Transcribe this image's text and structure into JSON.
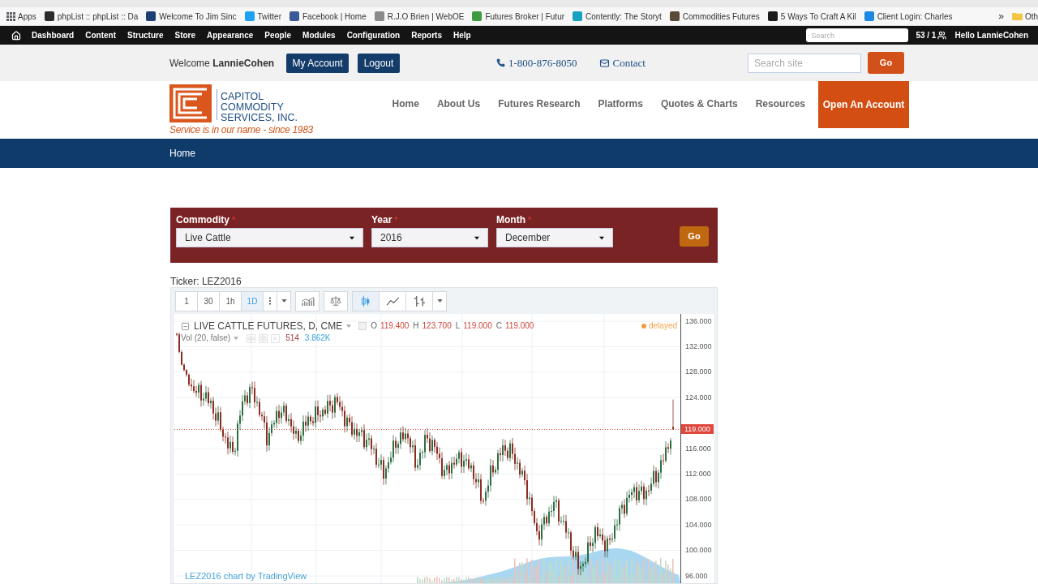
{
  "browser": {
    "apps": "Apps",
    "bookmarks": [
      "phpList :: phpList :: Da",
      "Welcome To Jim Sinc",
      "Twitter",
      "Facebook | Home",
      "R.J.O Brien | WebOE",
      "Futures Broker | Futur",
      "Contently: The Storyt",
      "Commodities Futures",
      "5 Ways To Craft A Kil",
      "Client Login: Charles"
    ],
    "overflow": "»",
    "other_bookmarks": "Oth"
  },
  "admin_toolbar": {
    "items": [
      "Dashboard",
      "Content",
      "Structure",
      "Store",
      "Appearance",
      "People",
      "Modules",
      "Configuration",
      "Reports",
      "Help"
    ],
    "search": {
      "placeholder": "Search"
    },
    "online_count": "53 / 1",
    "greeting": "Hello LannieCohen"
  },
  "header": {
    "welcome": "Welcome **LannieCohen**",
    "buttons": [
      "My Account",
      "Logout"
    ],
    "phone": "1-800-876-8050",
    "contact": "Contact",
    "search": {
      "placeholder": "Search site"
    },
    "search_button": "Go"
  },
  "logo": {
    "name_lines": [
      "CAPITOL",
      "COMMODITY",
      "SERVICES, INC."
    ],
    "tagline": "Service is in our name - since 1983"
  },
  "nav": {
    "items": [
      "Home",
      "About Us",
      "Futures Research",
      "Platforms",
      "Quotes & Charts",
      "Resources"
    ],
    "cta": "Open An Account"
  },
  "breadcrumb": [
    "Home"
  ],
  "selector": {
    "required_mark": "*",
    "fields": [
      {
        "label": "Commodity",
        "required": true,
        "value": "Live Cattle"
      },
      {
        "label": "Year",
        "required": true,
        "value": "2016"
      },
      {
        "label": "Month",
        "required": true,
        "value": "December"
      }
    ],
    "button": "Go"
  },
  "ticker": "Ticker: LEZ2016",
  "chart_widget": {
    "intervals": [
      {
        "label": "1",
        "selected": false
      },
      {
        "label": "30",
        "selected": false
      },
      {
        "label": "1h",
        "selected": false
      },
      {
        "label": "1D",
        "selected": true
      }
    ],
    "chart_styles": [
      {
        "kind": "candles",
        "selected": true
      },
      {
        "kind": "line",
        "selected": false
      },
      {
        "kind": "bars",
        "selected": false
      }
    ],
    "legend": {
      "title": "LIVE CATTLE FUTURES, D, CME",
      "ohlc": [
        {
          "key": "O",
          "value": "119.400"
        },
        {
          "key": "H",
          "value": "123.700"
        },
        {
          "key": "L",
          "value": "119.000"
        },
        {
          "key": "C",
          "value": "119.000"
        }
      ]
    },
    "volume": {
      "title": "Vol (20, false)",
      "values": [
        {
          "value": "514",
          "color": "#a8383a"
        },
        {
          "value": "3.862K",
          "color": "#3aa3dc"
        }
      ]
    },
    "status": "delayed",
    "price_scale": [
      {
        "kind": "tick",
        "label": "136.000"
      },
      {
        "kind": "tick",
        "label": "132.000"
      },
      {
        "kind": "tick",
        "label": "128.000"
      },
      {
        "kind": "tick",
        "label": "124.000"
      },
      {
        "kind": "last_price",
        "label": "119.000"
      },
      {
        "kind": "tick",
        "label": "116.000"
      },
      {
        "kind": "tick",
        "label": "112.000"
      },
      {
        "kind": "tick",
        "label": "108.000"
      },
      {
        "kind": "tick",
        "label": "104.000"
      },
      {
        "kind": "tick",
        "label": "100.000"
      },
      {
        "kind": "tick",
        "label": "96.000"
      }
    ],
    "attribution": "LEZ2016 chart by TradingView"
  }
}
